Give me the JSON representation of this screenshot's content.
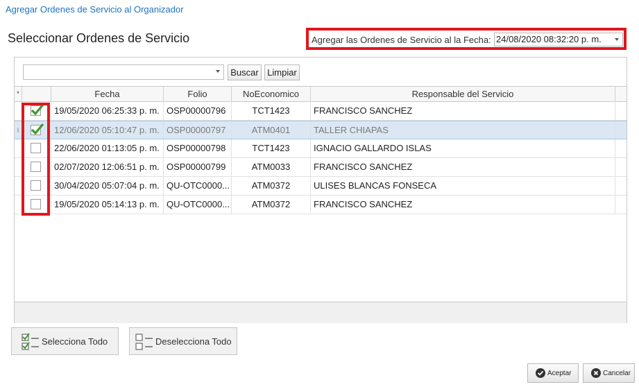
{
  "window_title": "Agregar Ordenes de Servicio al Organizador",
  "section_title": "Seleccionar Ordenes de Servicio",
  "date_label": "Agregar las Ordenes de Servicio al la Fecha:",
  "date_value": "24/08/2020 08:32:20 p. m.",
  "filter": {
    "value": "",
    "search_label": "Buscar",
    "clear_label": "Limpiar"
  },
  "grid": {
    "indicator_header": "*",
    "columns": [
      "Fecha",
      "Folio",
      "NoEconomico",
      "Responsable del Servicio"
    ],
    "rows": [
      {
        "checked": true,
        "fecha": "19/05/2020 06:25:33 p. m.",
        "folio": "OSP00000796",
        "noeconomico": "TCT1423",
        "responsable": "FRANCISCO SANCHEZ",
        "indicator": ""
      },
      {
        "checked": true,
        "fecha": "12/06/2020 05:10:47 p. m.",
        "folio": "OSP00000797",
        "noeconomico": "ATM0401",
        "responsable": "TALLER CHIAPAS",
        "indicator": "I"
      },
      {
        "checked": false,
        "fecha": "22/06/2020 01:13:05 p. m.",
        "folio": "OSP00000798",
        "noeconomico": "TCT1423",
        "responsable": "IGNACIO GALLARDO ISLAS",
        "indicator": ""
      },
      {
        "checked": false,
        "fecha": "02/07/2020 12:06:51 p. m.",
        "folio": "OSP00000799",
        "noeconomico": "ATM0033",
        "responsable": "FRANCISCO SANCHEZ",
        "indicator": ""
      },
      {
        "checked": false,
        "fecha": "30/04/2020 05:07:04 p. m.",
        "folio": "QU-OTC0000...",
        "noeconomico": "ATM0372",
        "responsable": "ULISES BLANCAS FONSECA",
        "indicator": ""
      },
      {
        "checked": false,
        "fecha": "19/05/2020 05:14:13 p. m.",
        "folio": "QU-OTC0000...",
        "noeconomico": "ATM0372",
        "responsable": "FRANCISCO SANCHEZ",
        "indicator": ""
      }
    ],
    "selected_row": 1
  },
  "buttons": {
    "select_all": "Selecciona Todo",
    "deselect_all": "Deselecciona Todo",
    "accept": "Aceptar",
    "cancel": "Cancelar"
  },
  "colors": {
    "highlight": "#e0161d",
    "title_blue": "#1e73be",
    "check_green": "#3f9a2f",
    "selected_row": "#dbe8f3"
  }
}
